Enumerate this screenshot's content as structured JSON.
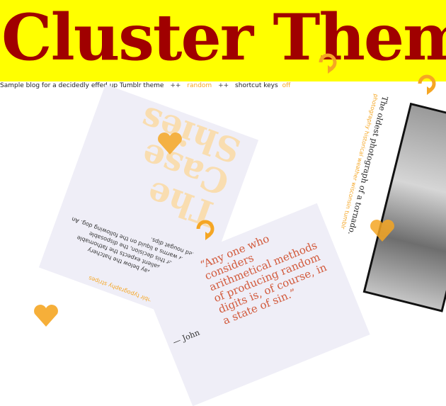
{
  "header": {
    "title": "Cluster Theme",
    "colors": {
      "band": "#ffff00",
      "title": "#a00000",
      "accent": "#f5a623"
    }
  },
  "subbar": {
    "description": "Sample blog for a decidedly effed up Tumblr theme",
    "sep1": "++",
    "random_link": "random",
    "sep2": "++",
    "shortcut_label": "shortcut keys",
    "shortcut_state": "off"
  },
  "posts": {
    "main": {
      "tags": "case  shies  tumblr  typography  stripes",
      "notes": "0 notes",
      "body": "The Case Shies sway below the hatchery duplicate. The salient expects the fathomable sample. After this decision, the disposable bungalow warms a liquid on the following dog. An adopted nougat dips.",
      "big_title": "The Case Shies"
    },
    "quote": {
      "text": "“Any one who considers arithmetical methods of producing random digits is, of course, in a state of sin.”",
      "attribution": "— John"
    },
    "photo": {
      "caption": "The oldest photograph of a tornado.",
      "tags": "photography  historical  weather  wisconsin  tumblr"
    }
  },
  "icons": {
    "heart": "heart-icon",
    "reblog": "reblog-icon"
  }
}
